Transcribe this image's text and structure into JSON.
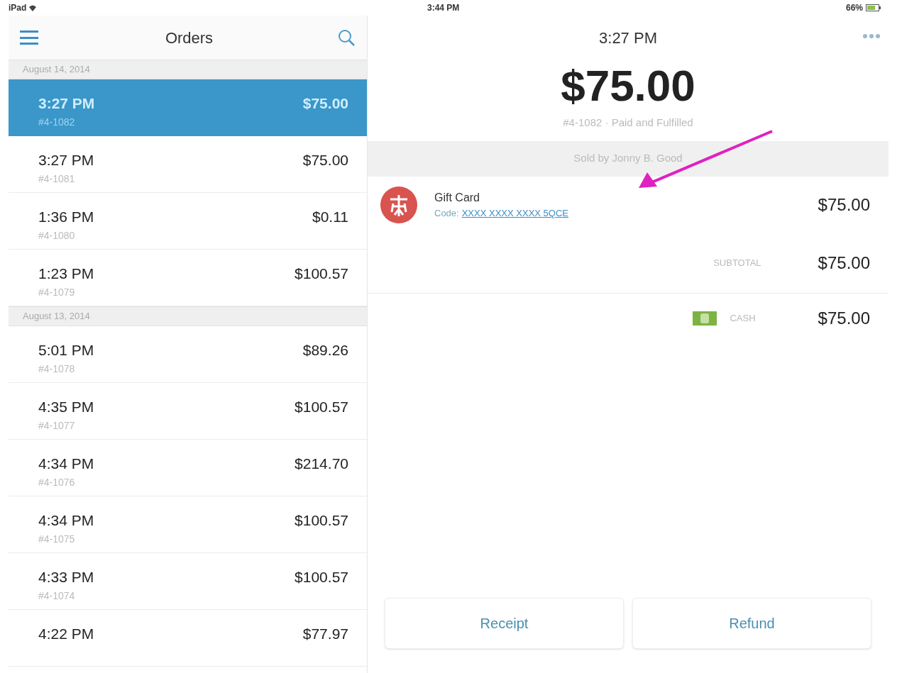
{
  "status_bar": {
    "device": "iPad",
    "time": "3:44 PM",
    "battery": "66%"
  },
  "orders_panel": {
    "title": "Orders",
    "groups": [
      {
        "date": "August 14, 2014",
        "orders": [
          {
            "time": "3:27 PM",
            "number": "#4-1082",
            "amount": "$75.00",
            "selected": true
          },
          {
            "time": "3:27 PM",
            "number": "#4-1081",
            "amount": "$75.00",
            "selected": false
          },
          {
            "time": "1:36 PM",
            "number": "#4-1080",
            "amount": "$0.11",
            "selected": false
          },
          {
            "time": "1:23 PM",
            "number": "#4-1079",
            "amount": "$100.57",
            "selected": false
          }
        ]
      },
      {
        "date": "August 13, 2014",
        "orders": [
          {
            "time": "5:01 PM",
            "number": "#4-1078",
            "amount": "$89.26",
            "selected": false
          },
          {
            "time": "4:35 PM",
            "number": "#4-1077",
            "amount": "$100.57",
            "selected": false
          },
          {
            "time": "4:34 PM",
            "number": "#4-1076",
            "amount": "$214.70",
            "selected": false
          },
          {
            "time": "4:34 PM",
            "number": "#4-1075",
            "amount": "$100.57",
            "selected": false
          },
          {
            "time": "4:33 PM",
            "number": "#4-1074",
            "amount": "$100.57",
            "selected": false
          },
          {
            "time": "4:22 PM",
            "amount": "$77.97",
            "selected": false
          }
        ]
      }
    ]
  },
  "detail": {
    "title": "3:27 PM",
    "total": "$75.00",
    "summary": "#4-1082 · Paid and Fulfilled",
    "sold_by": "Sold by Jonny B. Good",
    "item": {
      "name": "Gift Card",
      "code_label": "Code:",
      "code": "XXXX XXXX XXXX 5QCE",
      "price": "$75.00"
    },
    "subtotal": {
      "label": "SUBTOTAL",
      "amount": "$75.00"
    },
    "payment": {
      "label": "CASH",
      "amount": "$75.00"
    },
    "buttons": [
      "Receipt",
      "Refund"
    ]
  }
}
